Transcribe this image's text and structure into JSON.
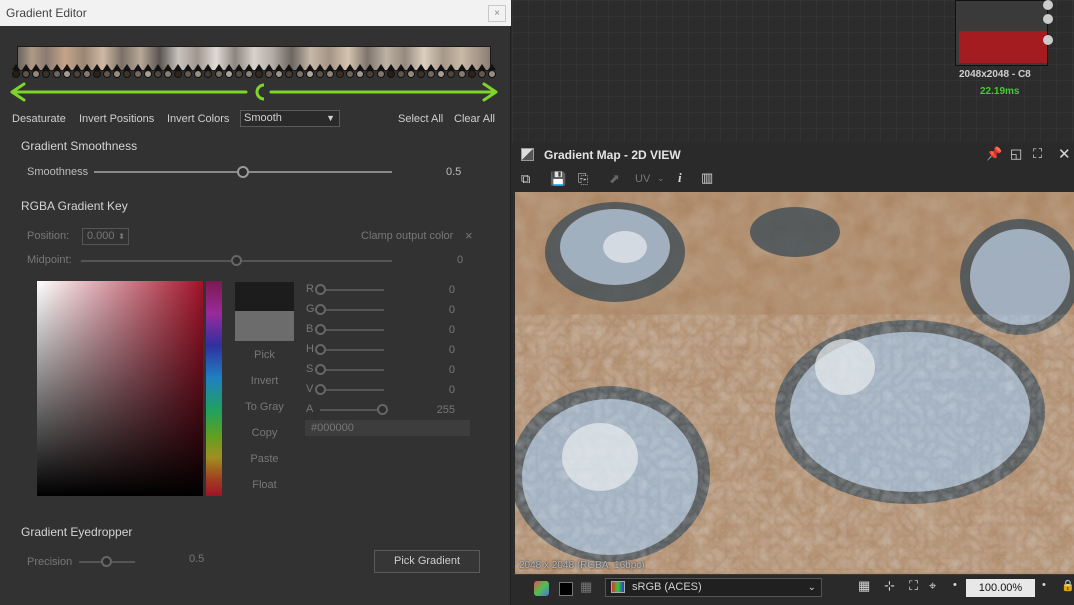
{
  "editor": {
    "title": "Gradient Editor",
    "close_label": "×",
    "toolbar": {
      "desaturate": "Desaturate",
      "invert_positions": "Invert Positions",
      "invert_colors": "Invert Colors",
      "interp_value": "Smooth",
      "select_all": "Select All",
      "clear_all": "Clear All"
    },
    "smoothness": {
      "heading": "Gradient Smoothness",
      "label": "Smoothness",
      "value": "0.5"
    },
    "rgba_key": {
      "heading": "RGBA Gradient Key",
      "position_label": "Position:",
      "position_value": "0.000",
      "clamp_label": "Clamp output color",
      "midpoint_label": "Midpoint:",
      "midpoint_value": "0"
    },
    "color_buttons": [
      "Pick",
      "Invert",
      "To Gray",
      "Copy",
      "Paste",
      "Float"
    ],
    "channels": [
      {
        "label": "R",
        "value": "0"
      },
      {
        "label": "G",
        "value": "0"
      },
      {
        "label": "B",
        "value": "0"
      },
      {
        "label": "H",
        "value": "0"
      },
      {
        "label": "S",
        "value": "0"
      },
      {
        "label": "V",
        "value": "0"
      },
      {
        "label": "A",
        "value": "255"
      }
    ],
    "hex": "#000000",
    "eyedropper": {
      "heading": "Gradient Eyedropper",
      "precision_label": "Precision",
      "precision_value": "0.5",
      "pick_button": "Pick Gradient"
    }
  },
  "node": {
    "resolution": "2048x2048 - C8",
    "time": "22.19ms"
  },
  "view": {
    "title": "Gradient Map - 2D VIEW",
    "uv_label": "UV",
    "image_info": "2048 x 2048 (RGBA, 16bpc)",
    "colorspace": "sRGB (ACES)",
    "zoom": "100.00%"
  },
  "colors": {
    "accent_green": "#7fd42a",
    "node_red": "#a51c20",
    "time_green": "#39d130"
  }
}
